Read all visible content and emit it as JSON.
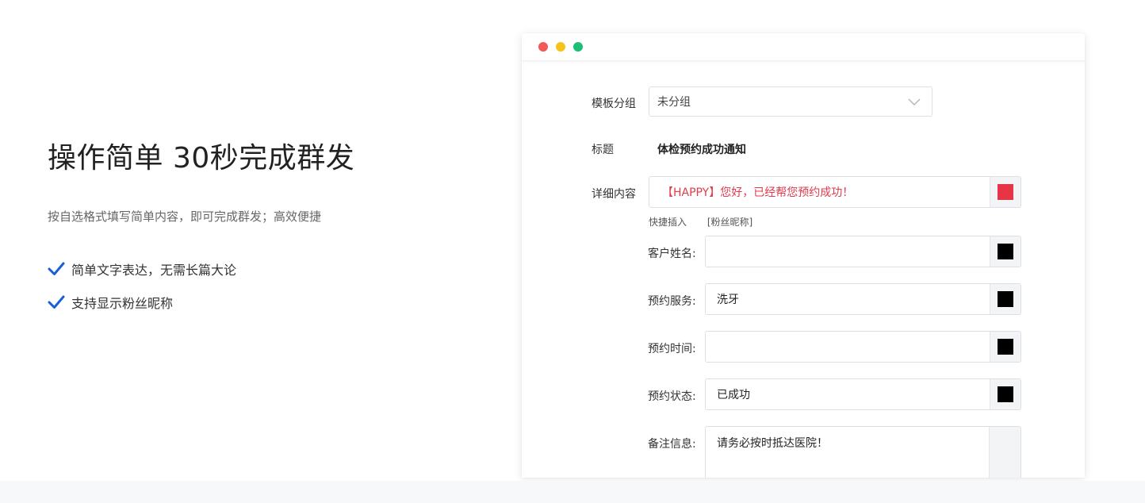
{
  "hero": {
    "title": "操作简单 30秒完成群发",
    "subtitle": "按自选格式填写简单内容，即可完成群发；高效便捷",
    "features": [
      "简单文字表达，无需长篇大论",
      "支持显示粉丝昵称"
    ],
    "check_color": "#1a5fd8"
  },
  "window": {
    "dots": [
      "#f25a5a",
      "#f7c21a",
      "#1cbf73"
    ],
    "template_group": {
      "label": "模板分组",
      "value": "未分组"
    },
    "title": {
      "label": "标题",
      "value": "体检预约成功通知"
    },
    "detail": {
      "label": "详细内容",
      "value": "【HAPPY】您好，已经帮您预约成功！",
      "color": "#e83545"
    },
    "quick_insert": {
      "label": "快捷插入",
      "tag": "[粉丝昵称]"
    },
    "fields": [
      {
        "label": "客户姓名:",
        "value": ""
      },
      {
        "label": "预约服务:",
        "value": "洗牙"
      },
      {
        "label": "预约时间:",
        "value": ""
      },
      {
        "label": "预约状态:",
        "value": "已成功"
      }
    ],
    "remark": {
      "label": "备注信息:",
      "value": "请务必按时抵达医院！"
    }
  }
}
